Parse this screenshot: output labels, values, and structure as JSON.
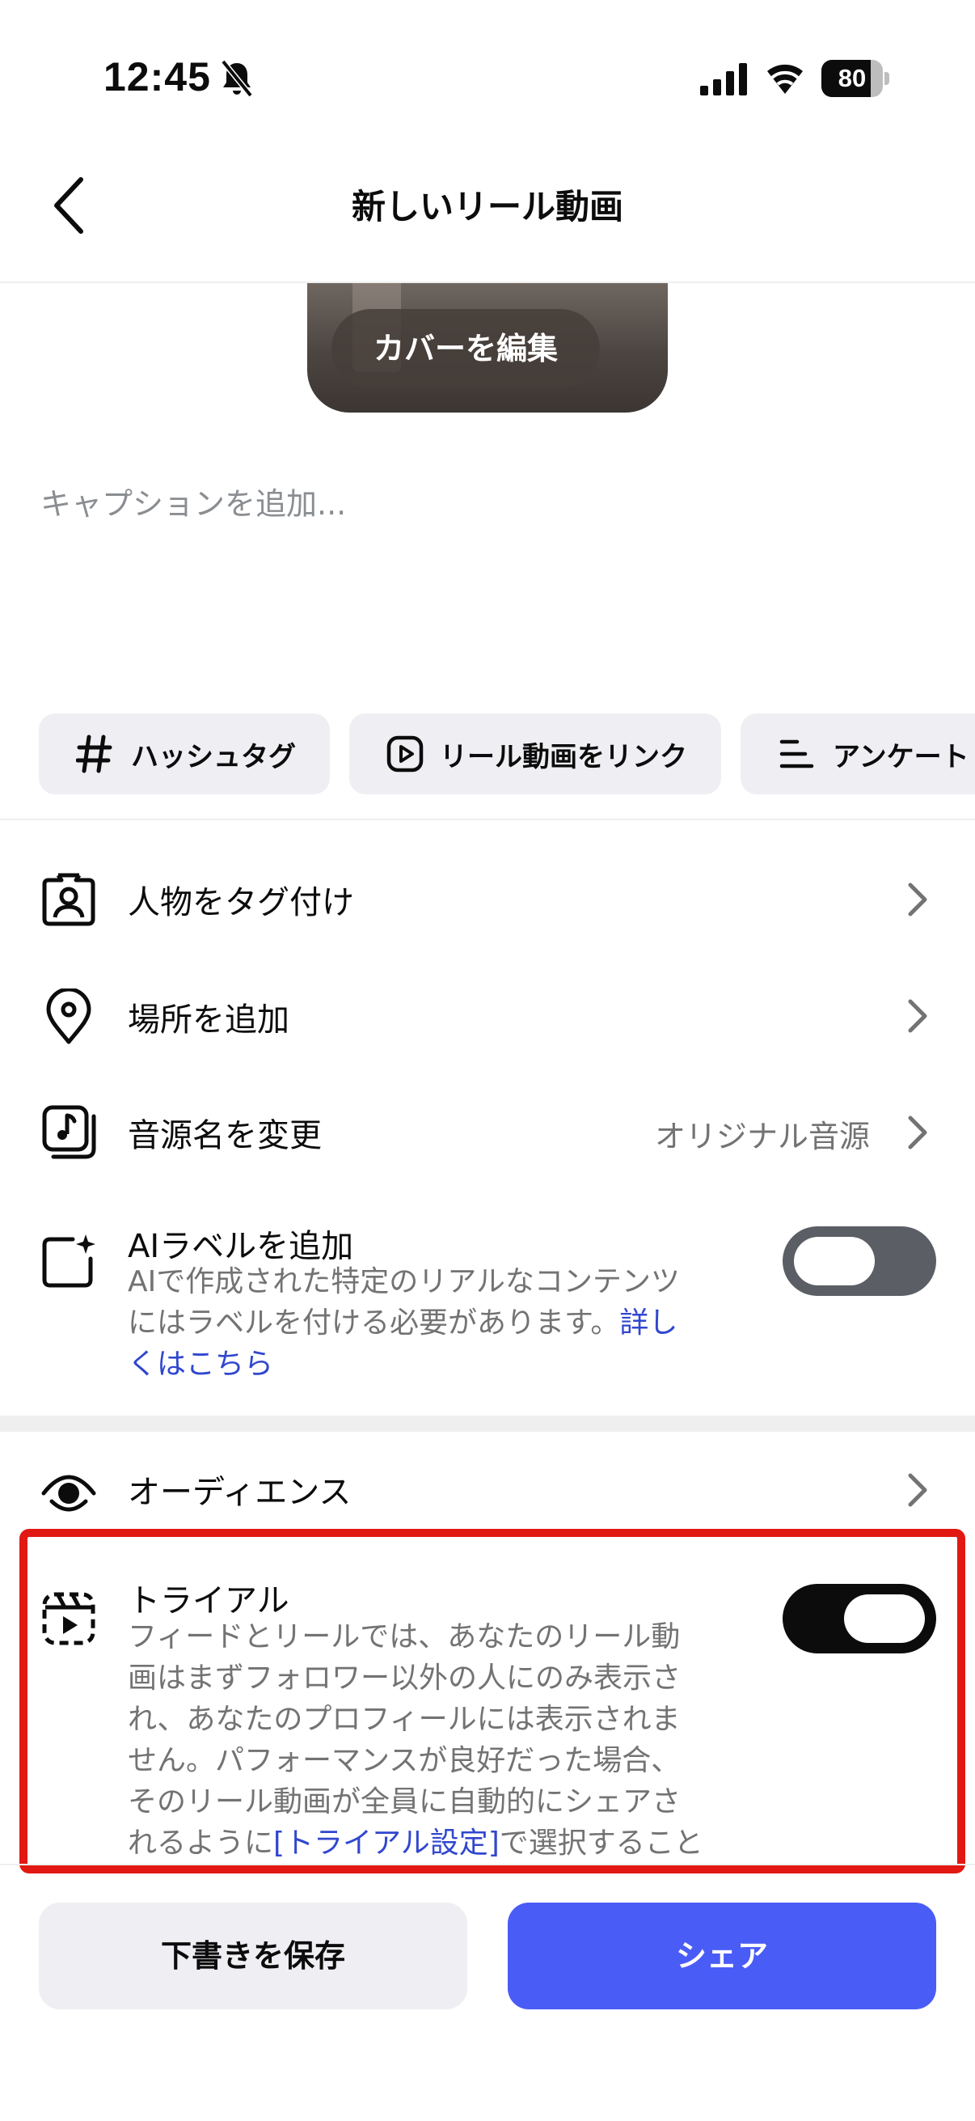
{
  "status_bar": {
    "time": "12:45",
    "battery": "80",
    "battery_level": 0.8
  },
  "header": {
    "title": "新しいリール動画"
  },
  "cover": {
    "edit_label": "カバーを編集"
  },
  "caption": {
    "placeholder": "キャプションを追加..."
  },
  "chips": [
    {
      "label": "ハッシュタグ",
      "icon": "hash-icon"
    },
    {
      "label": "リール動画をリンク",
      "icon": "reel-link-icon"
    },
    {
      "label": "アンケート",
      "icon": "poll-icon"
    }
  ],
  "rows": {
    "tag_people": {
      "label": "人物をタグ付け",
      "icon": "tag-person-icon"
    },
    "add_location": {
      "label": "場所を追加",
      "icon": "location-pin-icon"
    },
    "rename_audio": {
      "label": "音源名を変更",
      "value": "オリジナル音源",
      "icon": "music-note-icon"
    },
    "ai_label": {
      "label": "AIラベルを追加",
      "description_line1": "AIで作成された特定のリアルなコンテンツ",
      "description_line2": "にはラベルを付ける必要があります。",
      "link_part1": "詳し",
      "link_part2": "くはこちら",
      "toggle_on": false,
      "icon": "ai-sparkle-icon"
    },
    "audience": {
      "label": "オーディエンス",
      "icon": "audience-eye-icon"
    },
    "trial": {
      "label": "トライアル",
      "desc_line1": "フィードとリールでは、あなたのリール動",
      "desc_line2": "画はまずフォロワー以外の人にのみ表示さ",
      "desc_line3": "れ、あなたのプロフィールには表示されま",
      "desc_line4": "せん。パフォーマンスが良好だった場合、",
      "desc_line5": "そのリール動画が全員に自動的にシェアさ",
      "desc_line6_pre": "れるように",
      "desc_line6_link": "[トライアル設定]",
      "desc_line6_post": "で選択すること",
      "toggle_on": true,
      "icon": "trial-reel-icon"
    }
  },
  "actions": {
    "save_draft": "下書きを保存",
    "share": "シェア"
  },
  "colors": {
    "accent": "#4a5cf6",
    "link": "#3147ce",
    "highlight": "#e21912",
    "toggle_off": "#5b5f65",
    "toggle_on": "#0c0c0c"
  }
}
